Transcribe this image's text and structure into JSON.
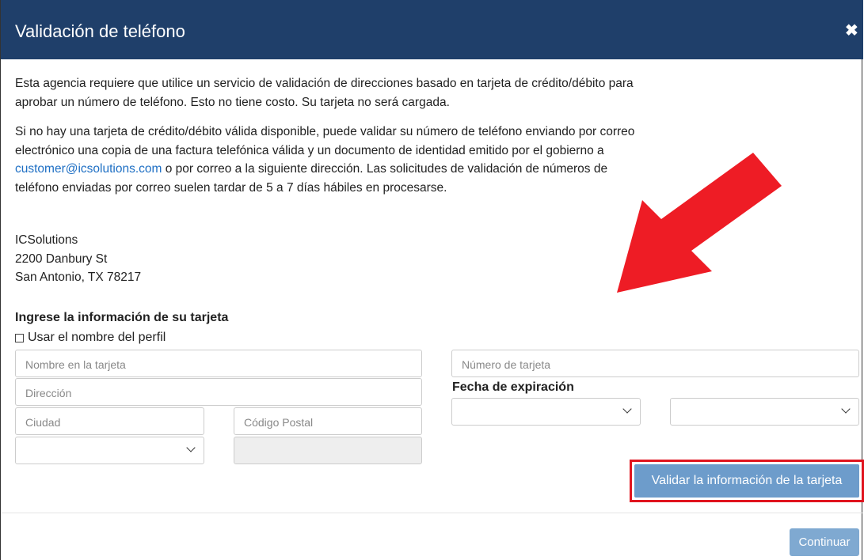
{
  "modal": {
    "title": "Validación de teléfono",
    "close_icon": "close-icon"
  },
  "body": {
    "para1": "Esta agencia requiere que utilice un servicio de validación de direcciones basado en tarjeta de crédito/débito para aprobar un número de teléfono. Esto no tiene costo. Su tarjeta no será cargada.",
    "para2_before": "Si no hay una tarjeta de crédito/débito válida disponible, puede validar su número de teléfono enviando por correo electrónico una copia de una factura telefónica válida y un documento de identidad emitido por el gobierno a ",
    "para2_link": "customer@icsolutions.com",
    "para2_after": " o por correo a la siguiente dirección. Las solicitudes de validación de números de teléfono enviadas por correo suelen tardar de 5 a 7 días hábiles en procesarse.",
    "address": {
      "line1": "ICSolutions",
      "line2": "2200 Danbury St",
      "line3": "San Antonio, TX 78217"
    }
  },
  "card_form": {
    "section_title": "Ingrese la información de su tarjeta",
    "use_profile_name_label": "Usar el nombre del perfil",
    "name_placeholder": "Nombre en la tarjeta",
    "address_placeholder": "Dirección",
    "city_placeholder": "Ciudad",
    "zip_placeholder": "Código Postal",
    "state_value": "",
    "card_number_placeholder": "Número de tarjeta",
    "expiration_label": "Fecha de expiración",
    "exp_month_value": "",
    "exp_year_value": "",
    "validate_button": "Validar la información de la tarjeta"
  },
  "footer": {
    "continue_button": "Continuar"
  },
  "colors": {
    "header_bg": "#1f3f6a",
    "button_bg": "#6d9ccb",
    "highlight_red": "#e0141e",
    "link": "#1e6fc4"
  }
}
